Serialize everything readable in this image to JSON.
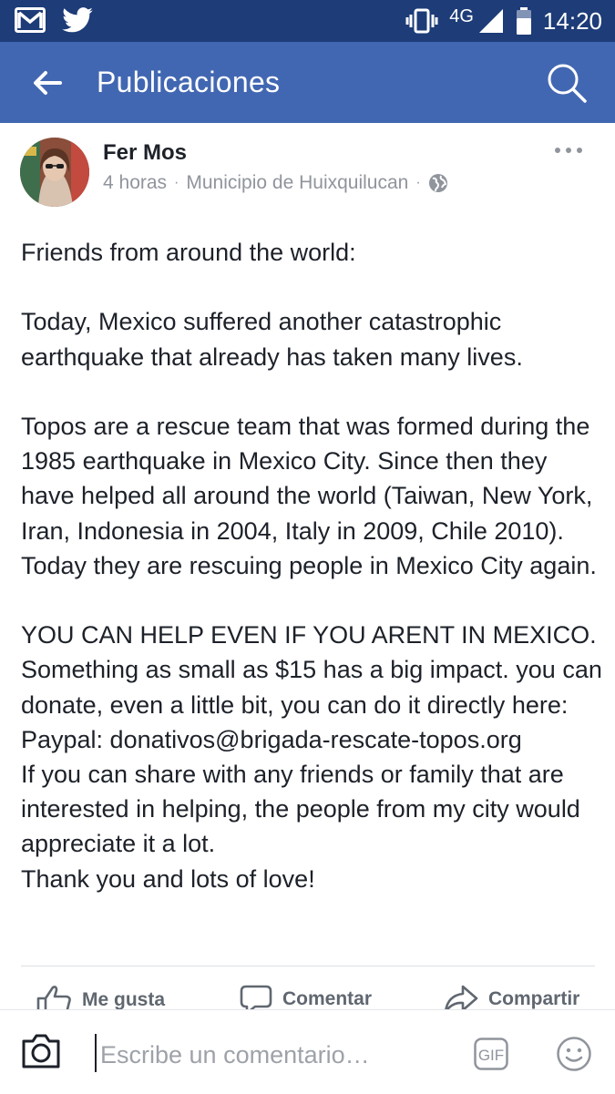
{
  "status_bar": {
    "network": "4G",
    "time": "14:20",
    "icons": [
      "gmail-icon",
      "twitter-icon",
      "vibrate-icon",
      "signal-icon",
      "battery-icon"
    ]
  },
  "app_bar": {
    "title": "Publicaciones",
    "back_icon": "back-arrow-icon",
    "search_icon": "search-icon",
    "background": "#4267b2"
  },
  "post": {
    "author": "Fer Mos",
    "time": "4 horas",
    "separator": "·",
    "location": "Municipio de Huixquilucan",
    "privacy_icon": "globe-icon",
    "body": [
      "Friends from around the world:",
      "",
      "Today, Mexico suffered another catastrophic earthquake that already has taken many lives.",
      "",
      "Topos are a rescue team that was formed during the 1985 earthquake in Mexico City. Since then they have helped all around the world (Taiwan, New York, Iran, Indonesia in 2004, Italy in 2009, Chile 2010). Today they are rescuing people in Mexico City again.",
      "",
      "YOU CAN HELP EVEN IF YOU ARENT IN MEXICO. Something as small as $15 has a big impact. you can donate, even a little bit, you can do it directly here:",
      "Paypal: donativos@brigada-rescate-topos.org",
      "If you can share with any friends or family that are interested in helping, the people from my city would appreciate it a lot.",
      "Thank you and lots of love!"
    ]
  },
  "actions": {
    "like": "Me gusta",
    "comment": "Comentar",
    "share": "Compartir"
  },
  "composer": {
    "placeholder": "Escribe un comentario…",
    "gif_label": "GIF"
  }
}
